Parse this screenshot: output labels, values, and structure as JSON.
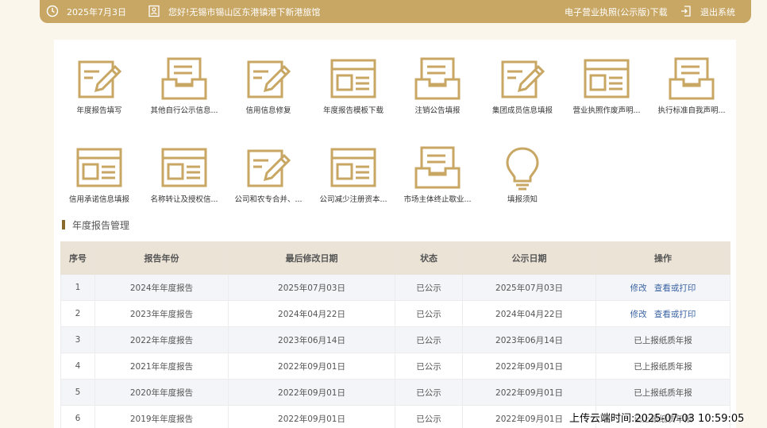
{
  "header": {
    "date": "2025年7月3日",
    "greeting": "您好!无锡市锡山区东港镇港下新港旅馆",
    "license_download": "电子营业执照(公示版)下载",
    "logout": "退出系统",
    "date_icon": "clock-icon",
    "user_icon": "id-card-icon",
    "logout_icon": "logout-icon"
  },
  "functions": [
    {
      "label": "年度报告填写",
      "icon": "edit-document-icon"
    },
    {
      "label": "其他自行公示信息...",
      "icon": "inbox-tray-icon"
    },
    {
      "label": "信用信息修复",
      "icon": "edit-document-icon"
    },
    {
      "label": "年度报告模板下载",
      "icon": "form-template-icon"
    },
    {
      "label": "注销公告填报",
      "icon": "inbox-tray-icon"
    },
    {
      "label": "集团成员信息填报",
      "icon": "edit-document-icon"
    },
    {
      "label": "营业执照作废声明...",
      "icon": "form-template-icon"
    },
    {
      "label": "执行标准自我声明...",
      "icon": "inbox-tray-icon"
    },
    {
      "label": "信用承诺信息填报",
      "icon": "form-template-icon"
    },
    {
      "label": "名称转让及授权信...",
      "icon": "form-template-icon"
    },
    {
      "label": "公司和农专合并、...",
      "icon": "edit-document-icon"
    },
    {
      "label": "公司减少注册资本...",
      "icon": "form-template-icon"
    },
    {
      "label": "市场主体终止歇业...",
      "icon": "inbox-tray-icon"
    },
    {
      "label": "填报须知",
      "icon": "lightbulb-icon"
    }
  ],
  "section": {
    "title": "年度报告管理"
  },
  "table": {
    "headers": [
      "序号",
      "报告年份",
      "最后修改日期",
      "状态",
      "公示日期",
      "操作"
    ],
    "rows": [
      {
        "no": "1",
        "year": "2024年年度报告",
        "modified": "2025年07月03日",
        "status": "已公示",
        "publish": "2025年07月03日",
        "op_edit": "修改",
        "op_view": "查看或打印",
        "op_text": ""
      },
      {
        "no": "2",
        "year": "2023年年度报告",
        "modified": "2024年04月22日",
        "status": "已公示",
        "publish": "2024年04月22日",
        "op_edit": "修改",
        "op_view": "查看或打印",
        "op_text": ""
      },
      {
        "no": "3",
        "year": "2022年年度报告",
        "modified": "2023年06月14日",
        "status": "已公示",
        "publish": "2023年06月14日",
        "op_edit": "",
        "op_view": "",
        "op_text": "已上报纸质年报"
      },
      {
        "no": "4",
        "year": "2021年年度报告",
        "modified": "2022年09月01日",
        "status": "已公示",
        "publish": "2022年09月01日",
        "op_edit": "",
        "op_view": "",
        "op_text": "已上报纸质年报"
      },
      {
        "no": "5",
        "year": "2020年年度报告",
        "modified": "2022年09月01日",
        "status": "已公示",
        "publish": "2022年09月01日",
        "op_edit": "",
        "op_view": "",
        "op_text": "已上报纸质年报"
      },
      {
        "no": "6",
        "year": "2019年年度报告",
        "modified": "2022年09月01日",
        "status": "已公示",
        "publish": "2022年09月01日",
        "op_edit": "",
        "op_view": "",
        "op_text": "已上报纸质年报"
      }
    ]
  },
  "watermark": "上传云端时间:2025-07-03 10:59:05",
  "colors": {
    "accent": "#c8a663",
    "header_row": "#ebe3d6",
    "link": "#3b63a3",
    "background": "#fbf6ec"
  }
}
